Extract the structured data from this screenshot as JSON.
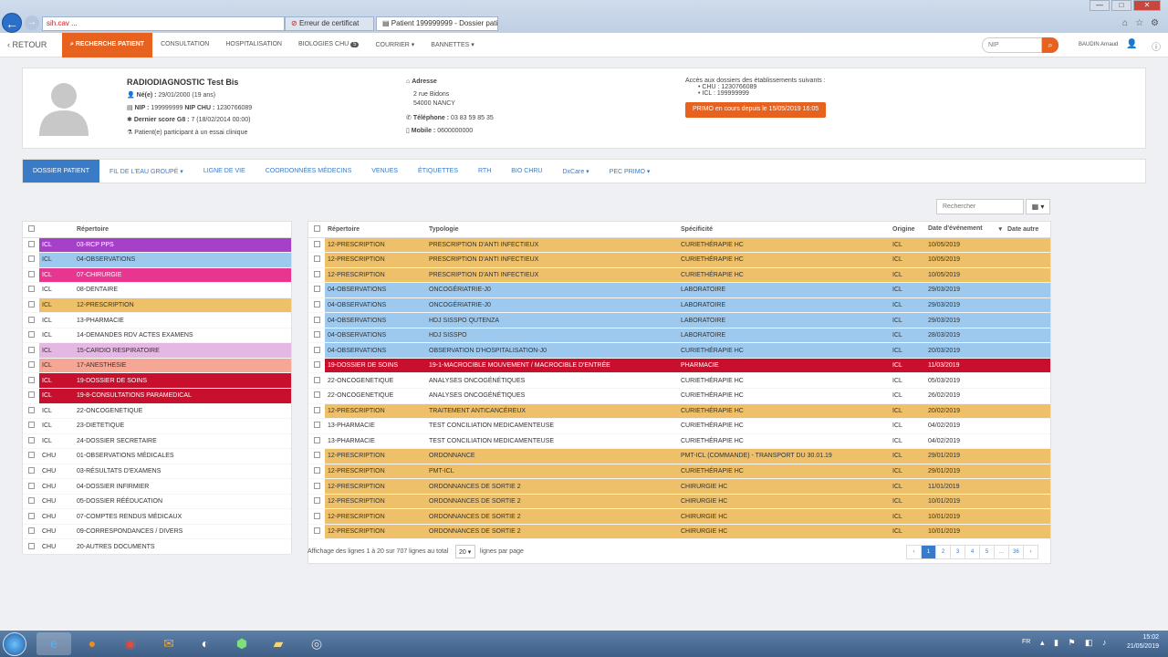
{
  "browser": {
    "back": "←",
    "forward": "→",
    "address_red": "sih.cav",
    "address_rest": " ...",
    "tab1": "Erreur de certificat",
    "tab2": "Patient 199999999 - Dossier patient",
    "win_min": "—",
    "win_max": "□",
    "win_close": "✕"
  },
  "nav": {
    "retour": "RETOUR",
    "items": [
      "RECHERCHE PATIENT",
      "CONSULTATION",
      "HOSPITALISATION",
      "BIOLOGIES CHU",
      "COURRIER ▾",
      "BANNETTES ▾"
    ],
    "badge": "5",
    "nip_placeholder": "NIP",
    "user": "BAUDIN Arnaud"
  },
  "patient": {
    "name": "RADIODIAGNOSTIC Test Bis",
    "born_label": "Né(e) :",
    "born": "29/01/2000 (19 ans)",
    "nip_label": "NIP :",
    "nip": "199999999",
    "nipchu_label": "NIP CHU :",
    "nipchu": "1230766089",
    "g8_label": "Dernier score G8 :",
    "g8": "7 (18/02/2014 00:00)",
    "essai": "Patient(e) participant à un essai clinique",
    "addr_label": "Adresse",
    "addr1": "2 rue Bidons",
    "addr2": "54000 NANCY",
    "tel_label": "Téléphone :",
    "tel": "03 83 59 85 35",
    "mob_label": "Mobile :",
    "mob": "0600000000",
    "access_title": "Accès aux dossiers des établissements suivants :",
    "access_chu": "• CHU : 1230766089",
    "access_icl": "• ICL : 199999999",
    "primo": "PRIMO en cours depuis le 15/05/2019 16:05"
  },
  "dtabs": [
    "DOSSIER PATIENT",
    "FIL DE L'EAU GROUPÉ ▾",
    "LIGNE DE VIE",
    "COORDONNÉES MÉDECINS",
    "VENUES",
    "ÉTIQUETTES",
    "RTH",
    "BIO CHRU",
    "DxCare ▾",
    "PEC PRIMO ▾"
  ],
  "search_placeholder": "Rechercher",
  "colbtn": "▦ ▾",
  "left_table": {
    "header": "Répertoire",
    "rows": [
      {
        "org": "ICL",
        "rep": "03-RCP PPS",
        "color": "#a640c8",
        "fg": "#fff"
      },
      {
        "org": "ICL",
        "rep": "04-OBSERVATIONS",
        "color": "#9ec9ef",
        "fg": "#333"
      },
      {
        "org": "ICL",
        "rep": "07-CHIRURGIE",
        "color": "#e8368f",
        "fg": "#fff"
      },
      {
        "org": "ICL",
        "rep": "08-DENTAIRE",
        "color": "#ffffff",
        "fg": "#333"
      },
      {
        "org": "ICL",
        "rep": "12-PRESCRIPTION",
        "color": "#eec069",
        "fg": "#333"
      },
      {
        "org": "ICL",
        "rep": "13-PHARMACIE",
        "color": "#ffffff",
        "fg": "#333"
      },
      {
        "org": "ICL",
        "rep": "14-DEMANDES RDV ACTES EXAMENS",
        "color": "#ffffff",
        "fg": "#333"
      },
      {
        "org": "ICL",
        "rep": "15-CARDIO RESPIRATOIRE",
        "color": "#e5b7e3",
        "fg": "#333"
      },
      {
        "org": "ICL",
        "rep": "17-ANESTHESIE",
        "color": "#f6a695",
        "fg": "#333"
      },
      {
        "org": "ICL",
        "rep": "19-DOSSIER DE SOINS",
        "color": "#c8102e",
        "fg": "#fff"
      },
      {
        "org": "ICL",
        "rep": "19-8-CONSULTATIONS PARAMEDICAL",
        "color": "#c8102e",
        "fg": "#fff"
      },
      {
        "org": "ICL",
        "rep": "22-ONCOGENETIQUE",
        "color": "#ffffff",
        "fg": "#333"
      },
      {
        "org": "ICL",
        "rep": "23-DIETETIQUE",
        "color": "#ffffff",
        "fg": "#333"
      },
      {
        "org": "ICL",
        "rep": "24-DOSSIER SECRETAIRE",
        "color": "#ffffff",
        "fg": "#333"
      },
      {
        "org": "CHU",
        "rep": "01-OBSERVATIONS MÉDICALES",
        "color": "#ffffff",
        "fg": "#333"
      },
      {
        "org": "CHU",
        "rep": "03-RÉSULTATS D'EXAMENS",
        "color": "#ffffff",
        "fg": "#333"
      },
      {
        "org": "CHU",
        "rep": "04-DOSSIER INFIRMIER",
        "color": "#ffffff",
        "fg": "#333"
      },
      {
        "org": "CHU",
        "rep": "05-DOSSIER RÉÉDUCATION",
        "color": "#ffffff",
        "fg": "#333"
      },
      {
        "org": "CHU",
        "rep": "07-COMPTES RENDUS MÉDICAUX",
        "color": "#ffffff",
        "fg": "#333"
      },
      {
        "org": "CHU",
        "rep": "09-CORRESPONDANCES / DIVERS",
        "color": "#ffffff",
        "fg": "#333"
      },
      {
        "org": "CHU",
        "rep": "20-AUTRES DOCUMENTS",
        "color": "#ffffff",
        "fg": "#333"
      }
    ]
  },
  "right_table": {
    "headers": [
      "Répertoire",
      "Typologie",
      "Spécificité",
      "Origine",
      "Date d'événement",
      "Date autre"
    ],
    "sort_icon": "▾",
    "rows": [
      {
        "rep": "12-PRESCRIPTION",
        "typ": "PRESCRIPTION D'ANTI INFECTIEUX",
        "spe": "CURIETHÉRAPIE HC",
        "ori": "ICL",
        "date": "10/05/2019",
        "color": "#eec069",
        "fg": "#333"
      },
      {
        "rep": "12-PRESCRIPTION",
        "typ": "PRESCRIPTION D'ANTI INFECTIEUX",
        "spe": "CURIETHÉRAPIE HC",
        "ori": "ICL",
        "date": "10/05/2019",
        "color": "#eec069",
        "fg": "#333"
      },
      {
        "rep": "12-PRESCRIPTION",
        "typ": "PRESCRIPTION D'ANTI INFECTIEUX",
        "spe": "CURIETHÉRAPIE HC",
        "ori": "ICL",
        "date": "10/05/2019",
        "color": "#eec069",
        "fg": "#333"
      },
      {
        "rep": "04-OBSERVATIONS",
        "typ": "ONCOGÉRIATRIE-J0",
        "spe": "LABORATOIRE",
        "ori": "ICL",
        "date": "29/03/2019",
        "color": "#9ec9ef",
        "fg": "#333"
      },
      {
        "rep": "04-OBSERVATIONS",
        "typ": "ONCOGÉRIATRIE-J0",
        "spe": "LABORATOIRE",
        "ori": "ICL",
        "date": "29/03/2019",
        "color": "#9ec9ef",
        "fg": "#333"
      },
      {
        "rep": "04-OBSERVATIONS",
        "typ": "HDJ SISSPO QUTENZA",
        "spe": "LABORATOIRE",
        "ori": "ICL",
        "date": "29/03/2019",
        "color": "#9ec9ef",
        "fg": "#333"
      },
      {
        "rep": "04-OBSERVATIONS",
        "typ": "HDJ SISSPO",
        "spe": "LABORATOIRE",
        "ori": "ICL",
        "date": "28/03/2019",
        "color": "#9ec9ef",
        "fg": "#333"
      },
      {
        "rep": "04-OBSERVATIONS",
        "typ": "OBSERVATION D'HOSPITALISATION-J0",
        "spe": "CURIETHÉRAPIE HC",
        "ori": "ICL",
        "date": "20/03/2019",
        "color": "#9ec9ef",
        "fg": "#333"
      },
      {
        "rep": "19-DOSSIER DE SOINS",
        "typ": "19-1-MACROCIBLE MOUVEMENT / MACROCIBLE D'ENTRÉE",
        "spe": "PHARMACIE",
        "ori": "ICL",
        "date": "11/03/2019",
        "color": "#c8102e",
        "fg": "#fff"
      },
      {
        "rep": "22-ONCOGENETIQUE",
        "typ": "ANALYSES ONCOGÉNÉTIQUES",
        "spe": "CURIETHÉRAPIE HC",
        "ori": "ICL",
        "date": "05/03/2019",
        "color": "#ffffff",
        "fg": "#333"
      },
      {
        "rep": "22-ONCOGENETIQUE",
        "typ": "ANALYSES ONCOGÉNÉTIQUES",
        "spe": "CURIETHÉRAPIE HC",
        "ori": "ICL",
        "date": "26/02/2019",
        "color": "#ffffff",
        "fg": "#333"
      },
      {
        "rep": "12-PRESCRIPTION",
        "typ": "TRAITEMENT ANTICANCÉREUX",
        "spe": "CURIETHÉRAPIE HC",
        "ori": "ICL",
        "date": "20/02/2019",
        "color": "#eec069",
        "fg": "#333"
      },
      {
        "rep": "13-PHARMACIE",
        "typ": "TEST CONCILIATION MEDICAMENTEUSE",
        "spe": "CURIETHÉRAPIE HC",
        "ori": "ICL",
        "date": "04/02/2019",
        "color": "#ffffff",
        "fg": "#333"
      },
      {
        "rep": "13-PHARMACIE",
        "typ": "TEST CONCILIATION MEDICAMENTEUSE",
        "spe": "CURIETHÉRAPIE HC",
        "ori": "ICL",
        "date": "04/02/2019",
        "color": "#ffffff",
        "fg": "#333"
      },
      {
        "rep": "12-PRESCRIPTION",
        "typ": "ORDONNANCE",
        "spe": "PMT-ICL (COMMANDE) - TRANSPORT DU 30.01.19",
        "ori": "ICL",
        "date": "29/01/2019",
        "color": "#eec069",
        "fg": "#333"
      },
      {
        "rep": "12-PRESCRIPTION",
        "typ": "PMT-ICL",
        "spe": "CURIETHÉRAPIE HC",
        "ori": "ICL",
        "date": "29/01/2019",
        "color": "#eec069",
        "fg": "#333"
      },
      {
        "rep": "12-PRESCRIPTION",
        "typ": "ORDONNANCES DE SORTIE 2",
        "spe": "CHIRURGIE HC",
        "ori": "ICL",
        "date": "11/01/2019",
        "color": "#eec069",
        "fg": "#333"
      },
      {
        "rep": "12-PRESCRIPTION",
        "typ": "ORDONNANCES DE SORTIE 2",
        "spe": "CHIRURGIE HC",
        "ori": "ICL",
        "date": "10/01/2019",
        "color": "#eec069",
        "fg": "#333"
      },
      {
        "rep": "12-PRESCRIPTION",
        "typ": "ORDONNANCES DE SORTIE 2",
        "spe": "CHIRURGIE HC",
        "ori": "ICL",
        "date": "10/01/2019",
        "color": "#eec069",
        "fg": "#333"
      },
      {
        "rep": "12-PRESCRIPTION",
        "typ": "ORDONNANCES DE SORTIE 2",
        "spe": "CHIRURGIE HC",
        "ori": "ICL",
        "date": "10/01/2019",
        "color": "#eec069",
        "fg": "#333"
      }
    ]
  },
  "footer": {
    "info": "Affichage des lignes 1 à 20 sur 707 lignes au total",
    "per_page": "20 ▾",
    "per_page_label": "lignes par page",
    "pages": [
      "‹",
      "1",
      "2",
      "3",
      "4",
      "5",
      "...",
      "36",
      "›"
    ]
  },
  "taskbar": {
    "lang": "FR",
    "time": "15:02",
    "date": "21/05/2019"
  }
}
